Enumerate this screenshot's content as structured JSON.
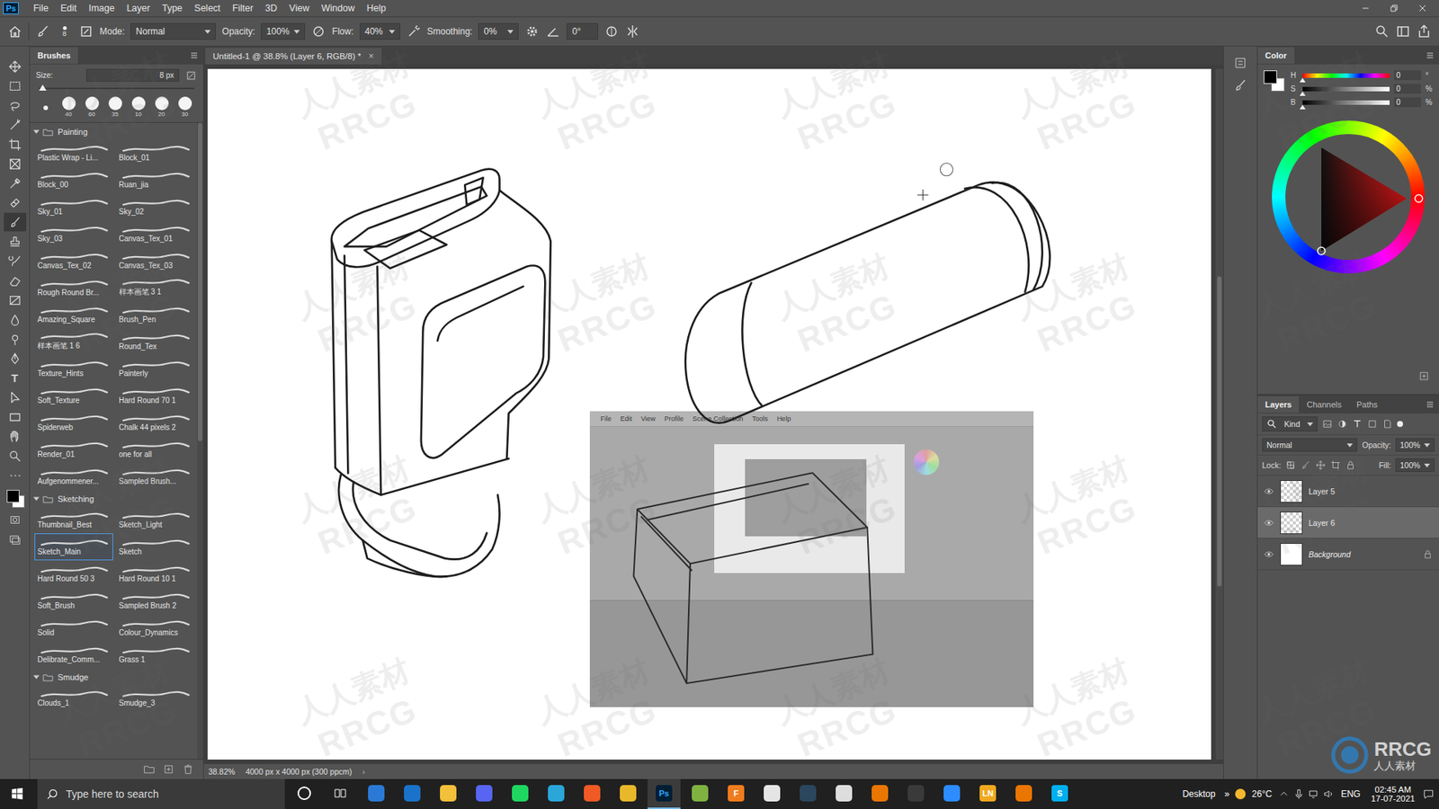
{
  "app_logo": "Ps",
  "menu": [
    "File",
    "Edit",
    "Image",
    "Layer",
    "Type",
    "Select",
    "Filter",
    "3D",
    "View",
    "Window",
    "Help"
  ],
  "options_bar": {
    "brush_size": "8",
    "mode_label": "Mode:",
    "mode": "Normal",
    "opacity_label": "Opacity:",
    "opacity": "100%",
    "flow_label": "Flow:",
    "flow": "40%",
    "smoothing_label": "Smoothing:",
    "smoothing": "0%",
    "angle": "0°"
  },
  "document_tab": {
    "title": "Untitled-1 @ 38.8% (Layer 6, RGB/8) *",
    "close": "×"
  },
  "tools": [
    {
      "kind": "move",
      "selected": false
    },
    {
      "kind": "marquee",
      "selected": false
    },
    {
      "kind": "lasso",
      "selected": false
    },
    {
      "kind": "wand",
      "selected": false
    },
    {
      "kind": "crop",
      "selected": false
    },
    {
      "kind": "frame",
      "selected": false
    },
    {
      "kind": "eyedropper",
      "selected": false
    },
    {
      "kind": "heal",
      "selected": false
    },
    {
      "kind": "brush",
      "selected": true
    },
    {
      "kind": "stamp",
      "selected": false
    },
    {
      "kind": "history",
      "selected": false
    },
    {
      "kind": "eraser",
      "selected": false
    },
    {
      "kind": "gradient",
      "selected": false
    },
    {
      "kind": "blur",
      "selected": false
    },
    {
      "kind": "dodge",
      "selected": false
    },
    {
      "kind": "pen",
      "selected": false
    },
    {
      "kind": "type",
      "selected": false,
      "label": "T"
    },
    {
      "kind": "path_select",
      "selected": false
    },
    {
      "kind": "rectangle",
      "selected": false
    },
    {
      "kind": "hand",
      "selected": false
    },
    {
      "kind": "zoom",
      "selected": false
    },
    {
      "kind": "more",
      "selected": false
    }
  ],
  "brushes_panel": {
    "title": "Brushes",
    "size_label": "Size:",
    "size": "8 px",
    "size_level": 0.02,
    "presets": [
      "40",
      "60",
      "35",
      "10",
      "20",
      "30"
    ],
    "groups": [
      {
        "name": "Painting",
        "expanded": true,
        "brushes": [
          {
            "name": "Plastic Wrap - Li...",
            "selected": false
          },
          {
            "name": "Block_01",
            "selected": false
          },
          {
            "name": "Block_00",
            "selected": false
          },
          {
            "name": "Ruan_jia",
            "selected": false
          },
          {
            "name": "Sky_01",
            "selected": false
          },
          {
            "name": "Sky_02",
            "selected": false
          },
          {
            "name": "Sky_03",
            "selected": false
          },
          {
            "name": "Canvas_Tex_01",
            "selected": false
          },
          {
            "name": "Canvas_Tex_02",
            "selected": false
          },
          {
            "name": "Canvas_Tex_03",
            "selected": false
          },
          {
            "name": "Rough Round Br...",
            "selected": false
          },
          {
            "name": "样本画笔 3 1",
            "selected": false
          },
          {
            "name": "Amazing_Square",
            "selected": false
          },
          {
            "name": "Brush_Pen",
            "selected": false
          },
          {
            "name": "样本画笔 1 6",
            "selected": false
          },
          {
            "name": "Round_Tex",
            "selected": false
          },
          {
            "name": "Texture_Hints",
            "selected": false
          },
          {
            "name": "Painterly",
            "selected": false
          },
          {
            "name": "Soft_Texture",
            "selected": false
          },
          {
            "name": "Hard Round 70 1",
            "selected": false
          },
          {
            "name": "Spiderweb",
            "selected": false
          },
          {
            "name": "Chalk 44 pixels 2",
            "selected": false
          },
          {
            "name": "Render_01",
            "selected": false
          },
          {
            "name": "one for all",
            "selected": false
          },
          {
            "name": "Aufgenommener...",
            "selected": false
          },
          {
            "name": "Sampled Brush...",
            "selected": false
          }
        ]
      },
      {
        "name": "Sketching",
        "expanded": true,
        "brushes": [
          {
            "name": "Thumbnail_Best",
            "selected": false
          },
          {
            "name": "Sketch_Light",
            "selected": false
          },
          {
            "name": "Sketch_Main",
            "selected": true
          },
          {
            "name": "Sketch",
            "selected": false
          },
          {
            "name": "Hard Round 50 3",
            "selected": false
          },
          {
            "name": "Hard Round 10 1",
            "selected": false
          },
          {
            "name": "Soft_Brush",
            "selected": false
          },
          {
            "name": "Sampled Brush 2",
            "selected": false
          },
          {
            "name": "Solid",
            "selected": false
          },
          {
            "name": "Colour_Dynamics",
            "selected": false
          },
          {
            "name": "Delibrate_Comm...",
            "selected": false
          },
          {
            "name": "Grass 1",
            "selected": false
          }
        ]
      },
      {
        "name": "Smudge",
        "expanded": true,
        "brushes": [
          {
            "name": "Clouds_1",
            "selected": false
          },
          {
            "name": "Smudge_3",
            "selected": false
          }
        ]
      }
    ]
  },
  "color_panel": {
    "title": "Color",
    "channels": [
      {
        "label": "H",
        "value": "0",
        "unit": "°",
        "level": 0
      },
      {
        "label": "S",
        "value": "0",
        "unit": "%",
        "level": 0
      },
      {
        "label": "B",
        "value": "0",
        "unit": "%",
        "level": 0
      }
    ]
  },
  "layers_panel": {
    "tabs": [
      {
        "label": "Layers",
        "selected": true
      },
      {
        "label": "Channels",
        "selected": false
      },
      {
        "label": "Paths",
        "selected": false
      }
    ],
    "filter": "Kind",
    "blend_mode": "Normal",
    "opacity_label": "Opacity:",
    "opacity": "100%",
    "lock_label": "Lock:",
    "fill_label": "Fill:",
    "fill": "100%",
    "layers": [
      {
        "name": "Layer 5",
        "visible": true,
        "selected": false,
        "locked": false,
        "kind": "transparent"
      },
      {
        "name": "Layer 6",
        "visible": true,
        "selected": true,
        "locked": false,
        "kind": "transparent"
      },
      {
        "name": "Background",
        "visible": true,
        "selected": false,
        "locked": true,
        "kind": "white"
      }
    ]
  },
  "reference_image": {
    "menu": [
      "File",
      "Edit",
      "View",
      "Profile",
      "Scene Collection",
      "Tools",
      "Help"
    ]
  },
  "status_bar": {
    "zoom": "38.82%",
    "doc_info": "4000 px x 4000 px (300 ppcm)",
    "arrow": "›"
  },
  "taskbar": {
    "search_placeholder": "Type here to search",
    "apps": [
      {
        "kind": "cortana",
        "active": false
      },
      {
        "kind": "taskview",
        "active": false
      },
      {
        "kind": "store",
        "active": false
      },
      {
        "kind": "mail",
        "active": false
      },
      {
        "kind": "explorer",
        "active": false
      },
      {
        "kind": "discord",
        "active": false
      },
      {
        "kind": "spotify",
        "active": false
      },
      {
        "kind": "edge",
        "active": false
      },
      {
        "kind": "brave",
        "active": false
      },
      {
        "kind": "chrome",
        "active": false
      },
      {
        "kind": "photoshop",
        "active": true,
        "label": "Ps"
      },
      {
        "kind": "greenapp",
        "active": false
      },
      {
        "kind": "fusion",
        "active": false,
        "label": "F"
      },
      {
        "kind": "inkscape",
        "active": false
      },
      {
        "kind": "steam",
        "active": false
      },
      {
        "kind": "searchapp",
        "active": false
      },
      {
        "kind": "blender",
        "active": false
      },
      {
        "kind": "obs",
        "active": false
      },
      {
        "kind": "zoom",
        "active": false
      },
      {
        "kind": "ln",
        "active": false,
        "label": "LN"
      },
      {
        "kind": "blender",
        "active": false
      },
      {
        "kind": "skype",
        "active": false,
        "label": "S"
      }
    ],
    "desktop_label": "Desktop",
    "chevron": "»",
    "weather": "26°C",
    "language": "ENG",
    "time": "02:45 AM",
    "date": "17-07-2021"
  },
  "watermark": {
    "latin": "RRCG",
    "cjk": "人人素材"
  }
}
